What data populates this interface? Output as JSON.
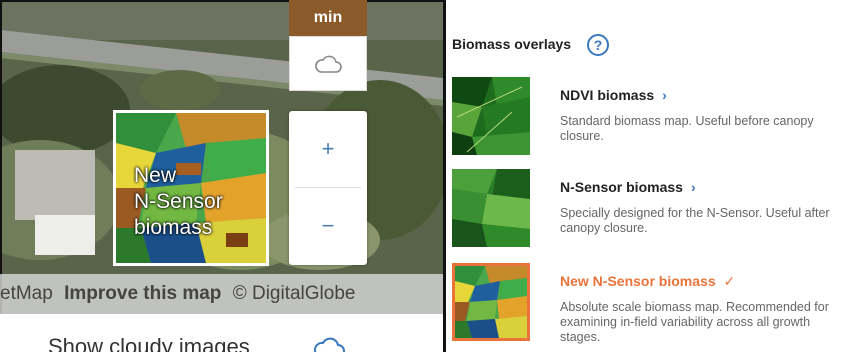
{
  "map": {
    "min_label": "min",
    "zoom_in": "+",
    "zoom_out": "−",
    "overlay_thumb_lines": [
      "New",
      "N-Sensor",
      "biomass"
    ],
    "attribution": {
      "part1": "etMap",
      "improve_link": "Improve this map",
      "part2": "© DigitalGlobe"
    },
    "cloudy_label": "Show cloudy images"
  },
  "panel": {
    "title": "Biomass overlays",
    "help": "?",
    "cards": [
      {
        "name": "NDVI biomass",
        "desc": "Standard biomass map. Useful before canopy closure.",
        "marker": "›"
      },
      {
        "name": "N-Sensor biomass",
        "desc": "Specially designed for the N-Sensor. Useful after canopy closure.",
        "marker": "›"
      },
      {
        "name": "New N-Sensor biomass",
        "desc": "Absolute scale biomass map. Recommended for examining in-field variability across all growth stages.",
        "marker": "✓"
      }
    ]
  },
  "colors": {
    "accent": "#e9733a",
    "link": "#3a79c0",
    "badge": "#8b5a2b"
  }
}
